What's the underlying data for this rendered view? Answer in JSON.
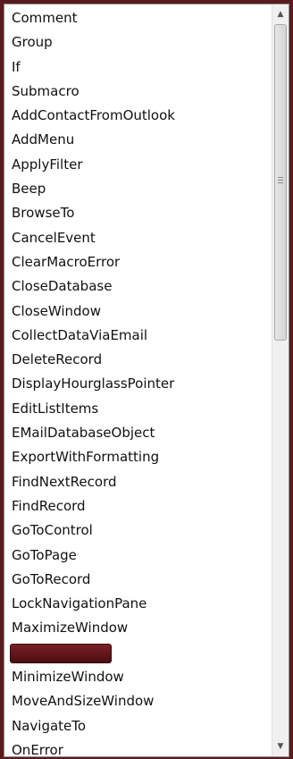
{
  "macro_actions": {
    "items": [
      "Comment",
      "Group",
      "If",
      "Submacro",
      "AddContactFromOutlook",
      "AddMenu",
      "ApplyFilter",
      "Beep",
      "BrowseTo",
      "CancelEvent",
      "ClearMacroError",
      "CloseDatabase",
      "CloseWindow",
      "CollectDataViaEmail",
      "DeleteRecord",
      "DisplayHourglassPointer",
      "EditListItems",
      "EMailDatabaseObject",
      "ExportWithFormatting",
      "FindNextRecord",
      "FindRecord",
      "GoToControl",
      "GoToPage",
      "GoToRecord",
      "LockNavigationPane",
      "MaximizeWindow",
      "",
      "MinimizeWindow",
      "MoveAndSizeWindow",
      "NavigateTo",
      "OnError"
    ],
    "highlighted_index": 26
  },
  "scrollbar": {
    "up_arrow_icon": "scroll-up-arrow-icon",
    "down_arrow_icon": "scroll-down-arrow-icon",
    "thumb_position_fraction": 0.0,
    "thumb_size_fraction": 0.44
  },
  "colors": {
    "background": "#5a1a1e",
    "highlight": "#5e161a"
  }
}
